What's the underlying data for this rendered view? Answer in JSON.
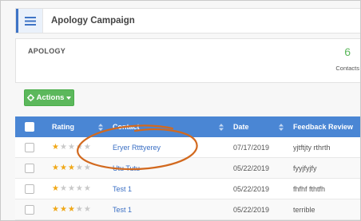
{
  "header": {
    "title": "Apology Campaign",
    "menu_icon": "hamburger-menu-icon",
    "accent": "#3f74c6"
  },
  "summary": {
    "campaign_name": "APOLOGY",
    "contacts_count": "6",
    "contacts_label": "Contacts",
    "count_color": "#5cb85c"
  },
  "actions": {
    "label": "Actions",
    "icon": "gear-icon",
    "caret_icon": "caret-down-icon",
    "color": "#5cb85c"
  },
  "table": {
    "header_color": "#4a86d4",
    "columns": {
      "rating": "Rating",
      "contact": "Contact",
      "date": "Date",
      "feedback": "Feedback Review"
    },
    "rows": [
      {
        "rating": 1,
        "contact": "Eryer Rtttyerey",
        "date": "07/17/2019",
        "feedback": "yjtftjty rthrth"
      },
      {
        "rating": 3,
        "contact": "Utu Tutu",
        "date": "05/22/2019",
        "feedback": "fyyjfyjfy"
      },
      {
        "rating": 1,
        "contact": "Test 1",
        "date": "05/22/2019",
        "feedback": "fhfhf fthtfh"
      },
      {
        "rating": 3,
        "contact": "Test 1",
        "date": "05/22/2019",
        "feedback": "terrible"
      }
    ]
  },
  "annotation": {
    "shape": "hand-drawn-ellipse",
    "color": "#d2691e"
  }
}
